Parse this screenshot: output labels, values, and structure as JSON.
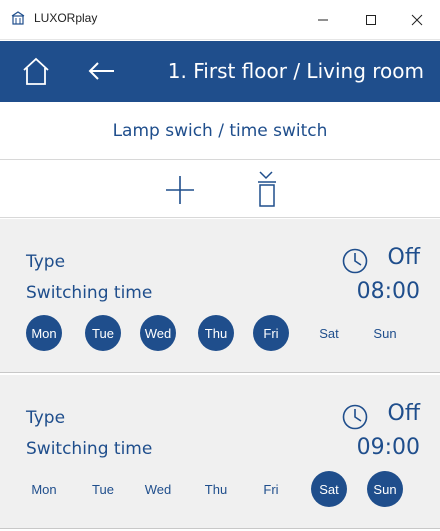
{
  "window": {
    "title": "LUXORplay",
    "minimize_glyph": "–",
    "maximize_glyph": "☐",
    "close_glyph": "✕"
  },
  "header": {
    "title": "1. First floor / Living room",
    "home_icon": "home-icon",
    "back_icon": "back-arrow-icon"
  },
  "subtitle": "Lamp swich / time switch",
  "toolbar": {
    "add_icon": "plus-icon",
    "delete_icon": "trash-icon"
  },
  "colors": {
    "accent": "#1f4e8c",
    "entry_bg": "#f0f0f0"
  },
  "entries": [
    {
      "type_label": "Type",
      "mode": "Off",
      "time_label": "Switching time",
      "time": "08:00",
      "days": [
        {
          "label": "Mon",
          "active": true
        },
        {
          "label": "Tue",
          "active": true
        },
        {
          "label": "Wed",
          "active": true
        },
        {
          "label": "Thu",
          "active": true
        },
        {
          "label": "Fri",
          "active": true
        },
        {
          "label": "Sat",
          "active": false
        },
        {
          "label": "Sun",
          "active": false
        }
      ]
    },
    {
      "type_label": "Type",
      "mode": "Off",
      "time_label": "Switching time",
      "time": "09:00",
      "days": [
        {
          "label": "Mon",
          "active": false
        },
        {
          "label": "Tue",
          "active": false
        },
        {
          "label": "Wed",
          "active": false
        },
        {
          "label": "Thu",
          "active": false
        },
        {
          "label": "Fri",
          "active": false
        },
        {
          "label": "Sat",
          "active": true
        },
        {
          "label": "Sun",
          "active": true
        }
      ]
    }
  ]
}
